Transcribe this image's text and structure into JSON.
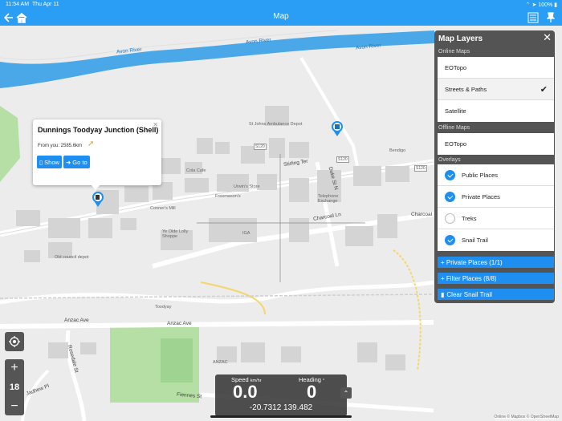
{
  "status_bar": {
    "time": "11:54 AM",
    "date": "Thu Apr 11",
    "battery": "100%"
  },
  "nav_bar": {
    "title": "Map",
    "back_icon": "back-arrow-icon",
    "home_icon": "home-icon",
    "list_icon": "list-icon",
    "pin_icon": "pin-icon"
  },
  "map": {
    "river_labels": [
      "Avon River",
      "Avon River",
      "Avon River"
    ],
    "place_labels": [
      "St Johns Ambulance Depot",
      "Bendigo",
      "Cola Cafe",
      "Urwin's Store",
      "Freemason's",
      "Telephone Exchange",
      "Conner's Mill",
      "Ye Olde Lolly Shoppe",
      "IGA",
      "Old council depot",
      "Toodyay",
      "ANZAC"
    ],
    "street_labels": [
      "Stirling Ter",
      "Duke St N",
      "Charcoal Ln",
      "Charcoal",
      "Anzac Ave",
      "Anzac Ave",
      "Fiennes St",
      "Rosedale St",
      "Jadhew Pl"
    ],
    "road_badges": [
      "S120",
      "S120",
      "S120"
    ],
    "attribution": "Online © Mapbox © OpenStreetMap"
  },
  "popup": {
    "title": "Dunnings Toodyay Junction (Shell)",
    "close": "✕",
    "distance": "From you: 2585.6km",
    "show_label": "Show",
    "goto_label": "Go to"
  },
  "layers_panel": {
    "title": "Map Layers",
    "close": "✕",
    "online_label": "Online Maps",
    "online_maps": [
      {
        "label": "EOTopo",
        "selected": false
      },
      {
        "label": "Streets & Paths",
        "selected": true
      },
      {
        "label": "Satellite",
        "selected": false
      }
    ],
    "offline_label": "Offline Maps",
    "offline_maps": [
      {
        "label": "EOTopo"
      }
    ],
    "overlays_label": "Overlays",
    "overlays": [
      {
        "label": "Public Places",
        "checked": true
      },
      {
        "label": "Private Places",
        "checked": true
      },
      {
        "label": "Treks",
        "checked": false
      },
      {
        "label": "Snail Trail",
        "checked": true
      }
    ],
    "private_places_btn": "+ Private Places (1/1)",
    "filter_places_btn": "+ Filter Places (8/8)",
    "clear_trail_btn": "Clear Snail Trail"
  },
  "controls": {
    "zoom_level": "18",
    "zoom_in": "+",
    "zoom_out": "−"
  },
  "speed_box": {
    "speed_label": "Speed",
    "speed_unit": "km/hr",
    "speed_value": "0.0",
    "heading_label": "Heading",
    "heading_unit": "°",
    "heading_value": "0",
    "coords": "-20.7312 139.482"
  },
  "colors": {
    "accent": "#1e8ef0",
    "nav": "#2a9df4",
    "river": "#4aa8e8",
    "park": "#b5dfa5"
  }
}
